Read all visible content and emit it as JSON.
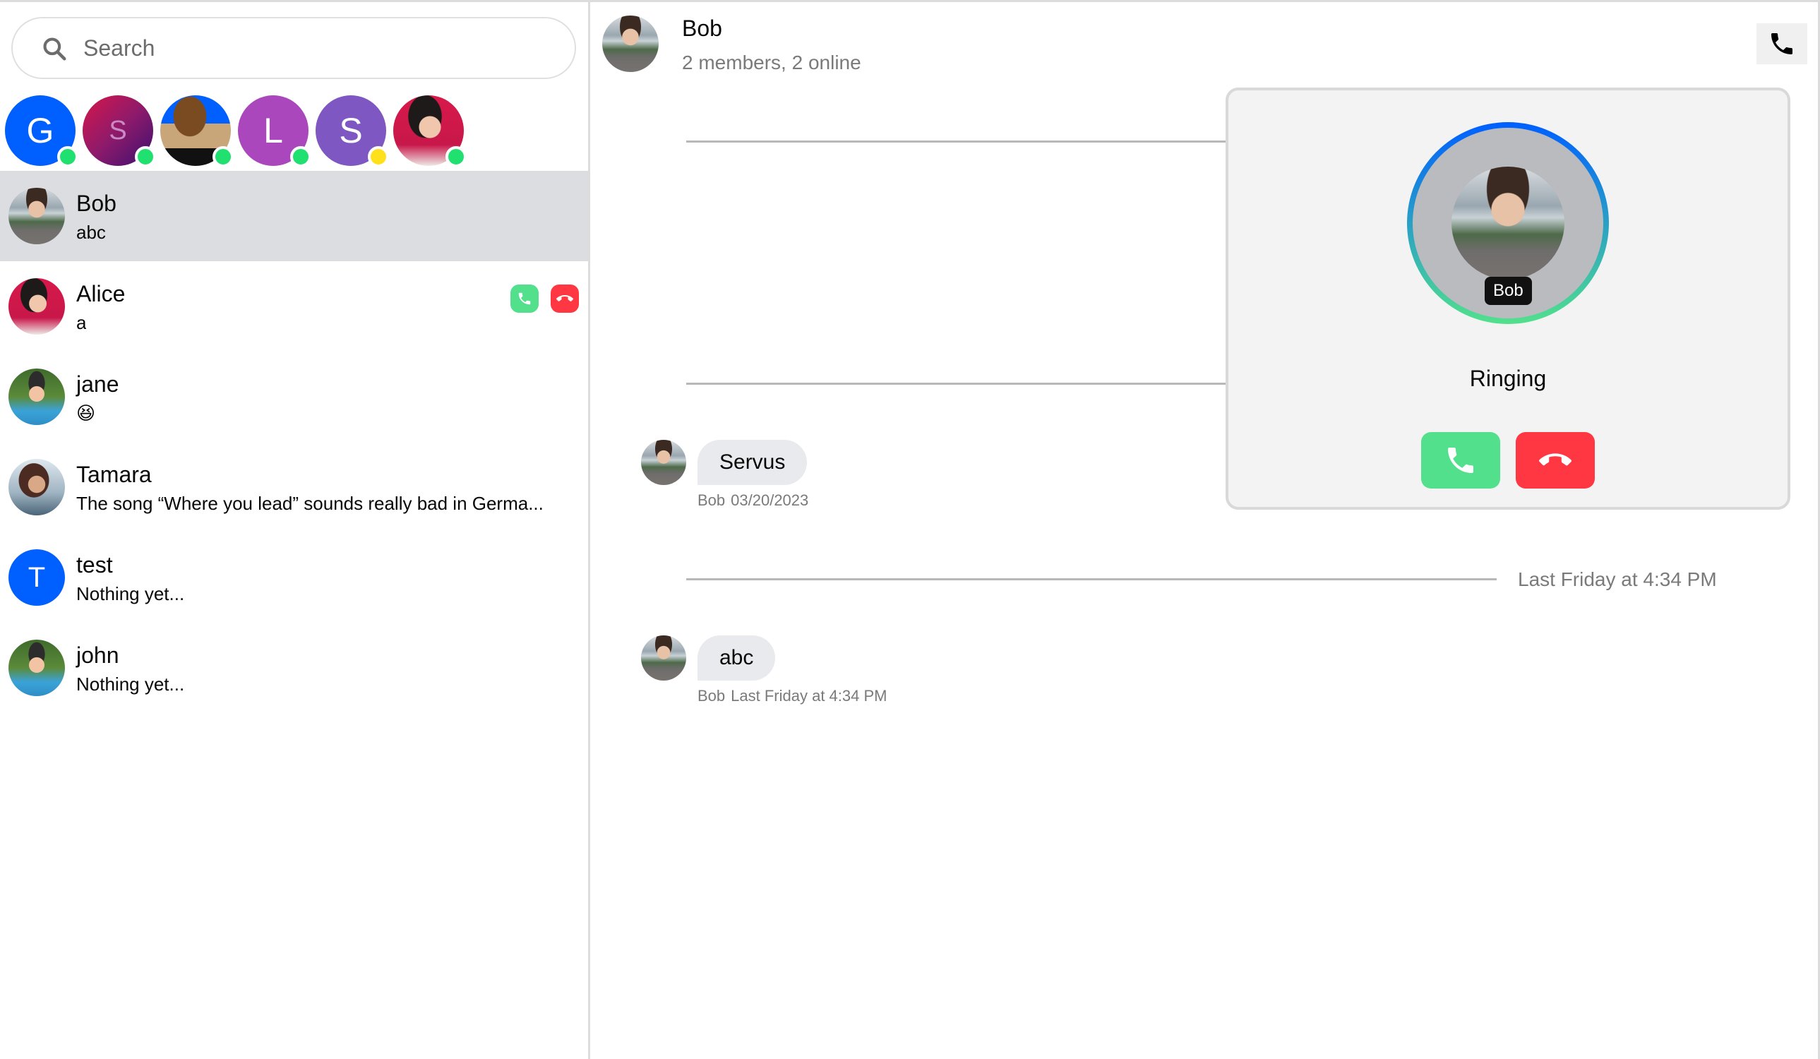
{
  "search": {
    "placeholder": "Search",
    "icon": "search-icon"
  },
  "online_users": [
    {
      "initial": "G",
      "color": "#005fff",
      "status": "online",
      "status_color": "#20e070",
      "kind": "letter"
    },
    {
      "initial": "S",
      "color": "#8e1a6b",
      "status": "online",
      "status_color": "#20e070",
      "kind": "gradient-letter",
      "letter_color": "#c98ac6"
    },
    {
      "initial": "",
      "color": "#005fff",
      "status": "online",
      "status_color": "#20e070",
      "kind": "pixel-art"
    },
    {
      "initial": "L",
      "color": "#ab47bc",
      "status": "online",
      "status_color": "#20e070",
      "kind": "letter"
    },
    {
      "initial": "S",
      "color": "#7e57c2",
      "status": "away",
      "status_color": "#ffe01b",
      "kind": "letter"
    },
    {
      "initial": "",
      "color": "#d8194a",
      "status": "online",
      "status_color": "#20e070",
      "kind": "photo-alice"
    }
  ],
  "channels": [
    {
      "name": "Bob",
      "preview": "abc",
      "active": true,
      "avatar": "photo-bob"
    },
    {
      "name": "Alice",
      "preview": "a",
      "active": false,
      "avatar": "photo-alice",
      "incoming_call": true,
      "accept_icon": "phone-icon",
      "reject_icon": "hang-up-icon"
    },
    {
      "name": "jane",
      "preview": "😆",
      "active": false,
      "avatar": "photo-jane"
    },
    {
      "name": "Tamara",
      "preview": "The song “Where you lead” sounds really bad in Germa...",
      "active": false,
      "avatar": "photo-tamara"
    },
    {
      "name": "test",
      "preview": "Nothing yet...",
      "active": false,
      "avatar": "letter",
      "initial": "T",
      "color": "#005fff"
    },
    {
      "name": "john",
      "preview": "Nothing yet...",
      "active": false,
      "avatar": "photo-jane"
    }
  ],
  "header": {
    "title": "Bob",
    "subtitle": "2 members, 2 online",
    "call_button_icon": "phone-icon"
  },
  "messages": {
    "separators": [
      {
        "label": ""
      },
      {
        "label": ""
      },
      {
        "label": "Last Friday at 4:34 PM"
      }
    ],
    "items": [
      {
        "text": "Servus",
        "author": "Bob",
        "timestamp": "03/20/2023"
      },
      {
        "text": "abc",
        "author": "Bob",
        "timestamp": "Last Friday at 4:34 PM"
      }
    ]
  },
  "call": {
    "caller_name": "Bob",
    "status": "Ringing",
    "accept_icon": "phone-icon",
    "reject_icon": "hang-up-icon",
    "colors": {
      "accept": "#52e08c",
      "reject": "#ff3742",
      "ring_top": "#005fff",
      "ring_bottom": "#52e08c"
    }
  }
}
